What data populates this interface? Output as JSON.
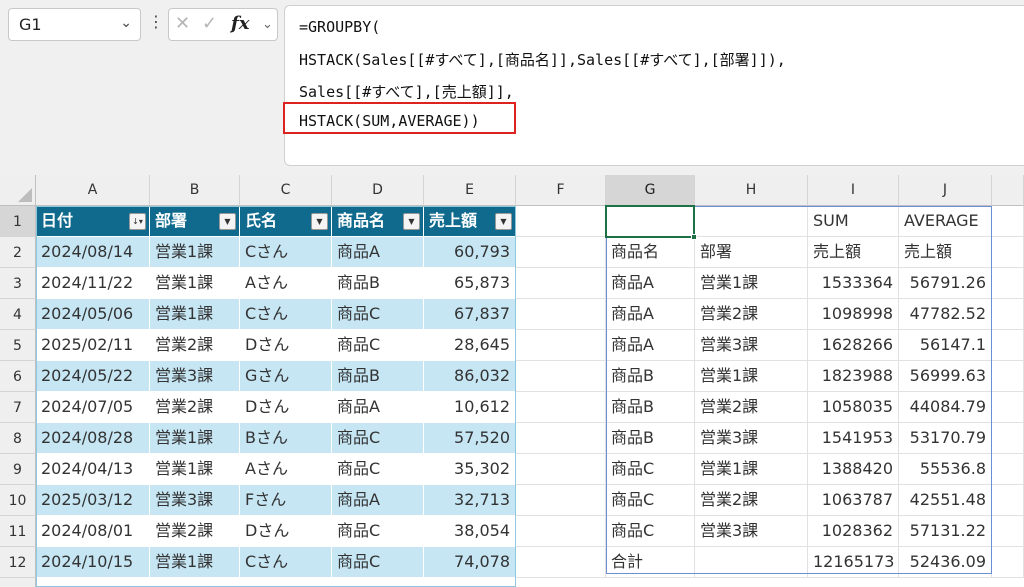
{
  "formula_bar": {
    "name_box": "G1",
    "lines": [
      "=GROUPBY(",
      "HSTACK(Sales[[#すべて],[商品名]],Sales[[#すべて],[部署]]),",
      "Sales[[#すべて],[売上額]],",
      "HSTACK(SUM,AVERAGE))"
    ]
  },
  "sheet": {
    "columns": [
      "A",
      "B",
      "C",
      "D",
      "E",
      "F",
      "G",
      "H",
      "I",
      "J"
    ],
    "rows": [
      "1",
      "2",
      "3",
      "4",
      "5",
      "6",
      "7",
      "8",
      "9",
      "10",
      "11",
      "12"
    ],
    "active_cell": "G1",
    "table": {
      "name": "Sales",
      "headers": [
        "日付",
        "部署",
        "氏名",
        "商品名",
        "売上額"
      ],
      "rows": [
        [
          "2024/08/14",
          "営業1課",
          "Cさん",
          "商品A",
          "60,793"
        ],
        [
          "2024/11/22",
          "営業1課",
          "Aさん",
          "商品B",
          "65,873"
        ],
        [
          "2024/05/06",
          "営業1課",
          "Cさん",
          "商品C",
          "67,837"
        ],
        [
          "2025/02/11",
          "営業2課",
          "Dさん",
          "商品C",
          "28,645"
        ],
        [
          "2024/05/22",
          "営業3課",
          "Gさん",
          "商品B",
          "86,032"
        ],
        [
          "2024/07/05",
          "営業2課",
          "Dさん",
          "商品A",
          "10,612"
        ],
        [
          "2024/08/28",
          "営業1課",
          "Bさん",
          "商品C",
          "57,520"
        ],
        [
          "2024/04/13",
          "営業1課",
          "Aさん",
          "商品C",
          "35,302"
        ],
        [
          "2025/03/12",
          "営業3課",
          "Fさん",
          "商品A",
          "32,713"
        ],
        [
          "2024/08/01",
          "営業2課",
          "Dさん",
          "商品C",
          "38,054"
        ],
        [
          "2024/10/15",
          "営業1課",
          "Cさん",
          "商品C",
          "74,078"
        ]
      ]
    },
    "spill": {
      "rows": [
        [
          "",
          "",
          "SUM",
          "AVERAGE"
        ],
        [
          "商品名",
          "部署",
          "売上額",
          "売上額"
        ],
        [
          "商品A",
          "営業1課",
          "1533364",
          "56791.26"
        ],
        [
          "商品A",
          "営業2課",
          "1098998",
          "47782.52"
        ],
        [
          "商品A",
          "営業3課",
          "1628266",
          "56147.1"
        ],
        [
          "商品B",
          "営業1課",
          "1823988",
          "56999.63"
        ],
        [
          "商品B",
          "営業2課",
          "1058035",
          "44084.79"
        ],
        [
          "商品B",
          "営業3課",
          "1541953",
          "53170.79"
        ],
        [
          "商品C",
          "営業1課",
          "1388420",
          "55536.8"
        ],
        [
          "商品C",
          "営業2課",
          "1063787",
          "42551.48"
        ],
        [
          "商品C",
          "営業3課",
          "1028362",
          "57131.22"
        ],
        [
          "合計",
          "",
          "12165173",
          "52436.09"
        ]
      ]
    }
  },
  "colors": {
    "table_header": "#0f6a8e",
    "table_band": "#c6e6f4",
    "highlight_box": "#dd2222",
    "active_cell": "#1e7145"
  }
}
